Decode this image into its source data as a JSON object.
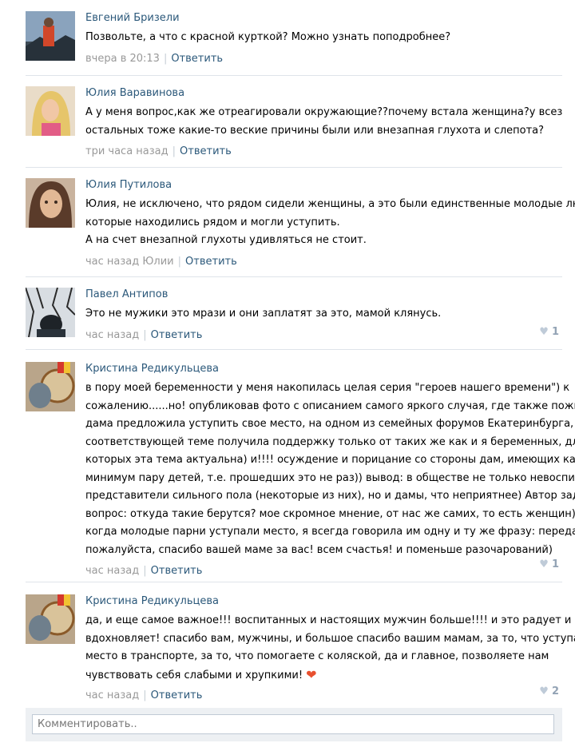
{
  "comments": [
    {
      "author": "Евгений Бризели",
      "avatar_icon": "avatar-photo",
      "lines": [
        "Позвольте, а что с красной курткой? Можно узнать поподробнее?"
      ],
      "time": "вчера в 20:13",
      "reply_label": "Ответить",
      "likes": ""
    },
    {
      "author": "Юлия Варавинова",
      "avatar_icon": "avatar-photo",
      "lines": [
        "А у меня вопрос,как же отреагировали окружающие??почему встала женщина?у всез",
        "остальных тоже какие-то веские причины были или внезапная глухота и слепота?"
      ],
      "time": "три часа назад",
      "reply_label": "Ответить",
      "likes": ""
    },
    {
      "author": "Юлия Путилова",
      "avatar_icon": "avatar-photo",
      "lines": [
        "Юлия, не исключено, что рядом сидели женщины, а это были единственные молодые люди,",
        "которые находились рядом и могли уступить.",
        "А на счет внезапной глухоты удивляться не стоит."
      ],
      "time": "час назад Юлии",
      "reply_label": "Ответить",
      "likes": ""
    },
    {
      "author": "Павел Антипов",
      "avatar_icon": "avatar-photo",
      "lines": [
        "Это не мужики это мрази и они заплатят за это, мамой клянусь."
      ],
      "time": "час назад",
      "reply_label": "Ответить",
      "likes": "1"
    },
    {
      "author": "Кристина Редикульцева",
      "avatar_icon": "avatar-photo",
      "lines": [
        "в пору моей беременности у меня накопилась целая серия \"героев нашего времени\") к",
        "сожалению......но! опубликовав фото с описанием самого яркого случая, где также пожилая",
        "дама предложила уступить свое место, на одном из семейных форумов Екатеринбурга, в",
        "соответствующей теме получила поддержку только от таких же как и я беременных, для",
        "которых эта тема актуальна) и!!!! осуждение и порицание со стороны дам, имеющих как",
        "минимум пару детей, т.е. прошедших это не раз)) вывод: в обществе не только невоспитаны",
        "представители сильного пола (некоторые из них), но и дамы, что неприятнее) Автор задала",
        "вопрос: откуда такие берутся? мое скромное мнение, от нас же самих, то есть женщин)) и",
        "когда молодые парни уступали место, я всегда говорила им одну и ту же фразу: передайте,",
        "пожалуйста, спасибо вашей маме за вас! всем счастья! и поменьше разочарований)"
      ],
      "time": "час назад",
      "reply_label": "Ответить",
      "likes": "1"
    },
    {
      "author": "Кристина Редикульцева",
      "avatar_icon": "avatar-photo",
      "lines": [
        "да, и еще самое важное!!! воспитанных и настоящих мужчин больше!!!! и это радует и",
        "вдохновляет! спасибо вам, мужчины, и большое спасибо вашим мамам, за то, что уступаете",
        "место в транспорте, за то, что помогаете с коляской, да и главное, позволяете нам",
        "чувствовать себя слабыми и хрупкими!"
      ],
      "emoji": "heart-emoji",
      "time": "час назад",
      "reply_label": "Ответить",
      "likes": "2"
    }
  ],
  "reply_box": {
    "placeholder": "Комментировать.."
  },
  "colors": {
    "link": "#2b587a",
    "meta": "#999999",
    "separator": "#dfe4ea",
    "emoji_heart": "#e8502f"
  }
}
